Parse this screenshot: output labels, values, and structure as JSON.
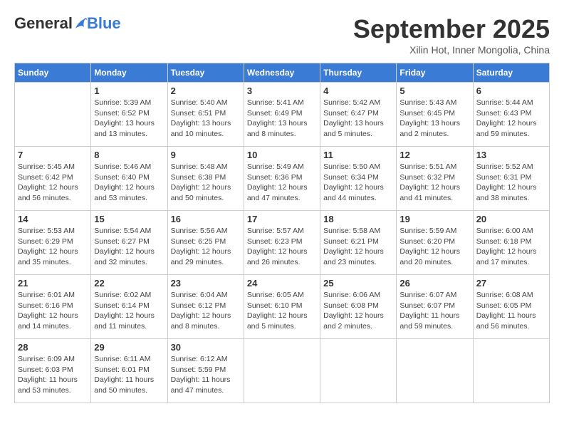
{
  "header": {
    "logo_general": "General",
    "logo_blue": "Blue",
    "month_title": "September 2025",
    "subtitle": "Xilin Hot, Inner Mongolia, China"
  },
  "weekdays": [
    "Sunday",
    "Monday",
    "Tuesday",
    "Wednesday",
    "Thursday",
    "Friday",
    "Saturday"
  ],
  "weeks": [
    [
      {
        "day": "",
        "sunrise": "",
        "sunset": "",
        "daylight": ""
      },
      {
        "day": "1",
        "sunrise": "Sunrise: 5:39 AM",
        "sunset": "Sunset: 6:52 PM",
        "daylight": "Daylight: 13 hours and 13 minutes."
      },
      {
        "day": "2",
        "sunrise": "Sunrise: 5:40 AM",
        "sunset": "Sunset: 6:51 PM",
        "daylight": "Daylight: 13 hours and 10 minutes."
      },
      {
        "day": "3",
        "sunrise": "Sunrise: 5:41 AM",
        "sunset": "Sunset: 6:49 PM",
        "daylight": "Daylight: 13 hours and 8 minutes."
      },
      {
        "day": "4",
        "sunrise": "Sunrise: 5:42 AM",
        "sunset": "Sunset: 6:47 PM",
        "daylight": "Daylight: 13 hours and 5 minutes."
      },
      {
        "day": "5",
        "sunrise": "Sunrise: 5:43 AM",
        "sunset": "Sunset: 6:45 PM",
        "daylight": "Daylight: 13 hours and 2 minutes."
      },
      {
        "day": "6",
        "sunrise": "Sunrise: 5:44 AM",
        "sunset": "Sunset: 6:43 PM",
        "daylight": "Daylight: 12 hours and 59 minutes."
      }
    ],
    [
      {
        "day": "7",
        "sunrise": "Sunrise: 5:45 AM",
        "sunset": "Sunset: 6:42 PM",
        "daylight": "Daylight: 12 hours and 56 minutes."
      },
      {
        "day": "8",
        "sunrise": "Sunrise: 5:46 AM",
        "sunset": "Sunset: 6:40 PM",
        "daylight": "Daylight: 12 hours and 53 minutes."
      },
      {
        "day": "9",
        "sunrise": "Sunrise: 5:48 AM",
        "sunset": "Sunset: 6:38 PM",
        "daylight": "Daylight: 12 hours and 50 minutes."
      },
      {
        "day": "10",
        "sunrise": "Sunrise: 5:49 AM",
        "sunset": "Sunset: 6:36 PM",
        "daylight": "Daylight: 12 hours and 47 minutes."
      },
      {
        "day": "11",
        "sunrise": "Sunrise: 5:50 AM",
        "sunset": "Sunset: 6:34 PM",
        "daylight": "Daylight: 12 hours and 44 minutes."
      },
      {
        "day": "12",
        "sunrise": "Sunrise: 5:51 AM",
        "sunset": "Sunset: 6:32 PM",
        "daylight": "Daylight: 12 hours and 41 minutes."
      },
      {
        "day": "13",
        "sunrise": "Sunrise: 5:52 AM",
        "sunset": "Sunset: 6:31 PM",
        "daylight": "Daylight: 12 hours and 38 minutes."
      }
    ],
    [
      {
        "day": "14",
        "sunrise": "Sunrise: 5:53 AM",
        "sunset": "Sunset: 6:29 PM",
        "daylight": "Daylight: 12 hours and 35 minutes."
      },
      {
        "day": "15",
        "sunrise": "Sunrise: 5:54 AM",
        "sunset": "Sunset: 6:27 PM",
        "daylight": "Daylight: 12 hours and 32 minutes."
      },
      {
        "day": "16",
        "sunrise": "Sunrise: 5:56 AM",
        "sunset": "Sunset: 6:25 PM",
        "daylight": "Daylight: 12 hours and 29 minutes."
      },
      {
        "day": "17",
        "sunrise": "Sunrise: 5:57 AM",
        "sunset": "Sunset: 6:23 PM",
        "daylight": "Daylight: 12 hours and 26 minutes."
      },
      {
        "day": "18",
        "sunrise": "Sunrise: 5:58 AM",
        "sunset": "Sunset: 6:21 PM",
        "daylight": "Daylight: 12 hours and 23 minutes."
      },
      {
        "day": "19",
        "sunrise": "Sunrise: 5:59 AM",
        "sunset": "Sunset: 6:20 PM",
        "daylight": "Daylight: 12 hours and 20 minutes."
      },
      {
        "day": "20",
        "sunrise": "Sunrise: 6:00 AM",
        "sunset": "Sunset: 6:18 PM",
        "daylight": "Daylight: 12 hours and 17 minutes."
      }
    ],
    [
      {
        "day": "21",
        "sunrise": "Sunrise: 6:01 AM",
        "sunset": "Sunset: 6:16 PM",
        "daylight": "Daylight: 12 hours and 14 minutes."
      },
      {
        "day": "22",
        "sunrise": "Sunrise: 6:02 AM",
        "sunset": "Sunset: 6:14 PM",
        "daylight": "Daylight: 12 hours and 11 minutes."
      },
      {
        "day": "23",
        "sunrise": "Sunrise: 6:04 AM",
        "sunset": "Sunset: 6:12 PM",
        "daylight": "Daylight: 12 hours and 8 minutes."
      },
      {
        "day": "24",
        "sunrise": "Sunrise: 6:05 AM",
        "sunset": "Sunset: 6:10 PM",
        "daylight": "Daylight: 12 hours and 5 minutes."
      },
      {
        "day": "25",
        "sunrise": "Sunrise: 6:06 AM",
        "sunset": "Sunset: 6:08 PM",
        "daylight": "Daylight: 12 hours and 2 minutes."
      },
      {
        "day": "26",
        "sunrise": "Sunrise: 6:07 AM",
        "sunset": "Sunset: 6:07 PM",
        "daylight": "Daylight: 11 hours and 59 minutes."
      },
      {
        "day": "27",
        "sunrise": "Sunrise: 6:08 AM",
        "sunset": "Sunset: 6:05 PM",
        "daylight": "Daylight: 11 hours and 56 minutes."
      }
    ],
    [
      {
        "day": "28",
        "sunrise": "Sunrise: 6:09 AM",
        "sunset": "Sunset: 6:03 PM",
        "daylight": "Daylight: 11 hours and 53 minutes."
      },
      {
        "day": "29",
        "sunrise": "Sunrise: 6:11 AM",
        "sunset": "Sunset: 6:01 PM",
        "daylight": "Daylight: 11 hours and 50 minutes."
      },
      {
        "day": "30",
        "sunrise": "Sunrise: 6:12 AM",
        "sunset": "Sunset: 5:59 PM",
        "daylight": "Daylight: 11 hours and 47 minutes."
      },
      {
        "day": "",
        "sunrise": "",
        "sunset": "",
        "daylight": ""
      },
      {
        "day": "",
        "sunrise": "",
        "sunset": "",
        "daylight": ""
      },
      {
        "day": "",
        "sunrise": "",
        "sunset": "",
        "daylight": ""
      },
      {
        "day": "",
        "sunrise": "",
        "sunset": "",
        "daylight": ""
      }
    ]
  ]
}
